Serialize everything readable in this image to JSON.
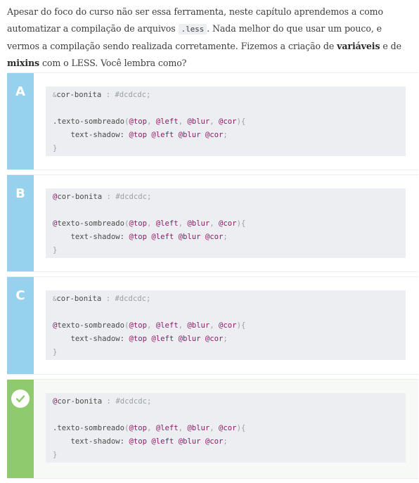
{
  "question": {
    "part1": "Apesar do foco do curso não ser essa ferramenta, neste capítulo aprendemos a como automatizar a compilação de arquivos ",
    "code": ".less",
    "part2": ". Nada melhor do que usar um pouco, e vermos a compilação sendo realizada corretamente. Fizemos a criação de ",
    "bold1": "variáveis",
    "part3": " e de ",
    "bold2": "mixins",
    "part4": " com o LESS. Você lembra como?"
  },
  "options": [
    {
      "letter": "A",
      "var_prefix": "&",
      "var_name": "cor-bonita",
      "var_sep": " : ",
      "var_value": "#dcdcdc;",
      "mixin_prefix": "",
      "mixin_name": ".texto-sombreado",
      "params_open": "(",
      "p1": "@top",
      "p2": "@left",
      "p3": "@blur",
      "p4": "@cor",
      "params_close": ")",
      "brace_open": "{",
      "prop": "text-shadow: ",
      "v1": "@top",
      "v2": "@left",
      "v3": "@blur",
      "v4": "@cor",
      "semi": ";",
      "brace_close": "}"
    },
    {
      "letter": "B",
      "var_prefix": "@",
      "var_name": "cor-bonita",
      "var_sep": " : ",
      "var_value": "#dcdcdc;",
      "mixin_prefix": "@",
      "mixin_name": "texto-sombreado",
      "params_open": "(",
      "p1": "@top",
      "p2": "@left",
      "p3": "@blur",
      "p4": "@cor",
      "params_close": ")",
      "brace_open": "{",
      "prop": "text-shadow: ",
      "v1": "@top",
      "v2": "@left",
      "v3": "@blur",
      "v4": "@cor",
      "semi": ";",
      "brace_close": "}"
    },
    {
      "letter": "C",
      "var_prefix": "&",
      "var_name": "cor-bonita",
      "var_sep": " : ",
      "var_value": "#dcdcdc;",
      "mixin_prefix": "@",
      "mixin_name": "texto-sombreado",
      "params_open": "(",
      "p1": "@top",
      "p2": "@left",
      "p3": "@blur",
      "p4": "@cor",
      "params_close": ")",
      "brace_open": "{",
      "prop": "text-shadow: ",
      "v1": "@top",
      "v2": "@left",
      "v3": "@blur",
      "v4": "@cor",
      "semi": ";",
      "brace_close": "}"
    },
    {
      "letter": "",
      "var_prefix": "@",
      "var_name": "cor-bonita",
      "var_sep": " : ",
      "var_value": "#dcdcdc;",
      "mixin_prefix": "",
      "mixin_name": ".texto-sombreado",
      "params_open": "(",
      "p1": "@top",
      "p2": "@left",
      "p3": "@blur",
      "p4": "@cor",
      "params_close": ")",
      "brace_open": "{",
      "prop": "text-shadow: ",
      "v1": "@top",
      "v2": "@left",
      "v3": "@blur",
      "v4": "@cor",
      "semi": ";",
      "brace_close": "}"
    }
  ],
  "correct_icon": "check-icon",
  "colors": {
    "letter_bar": "#96d1ee",
    "correct_bar": "#8fca6e",
    "code_bg": "#eceef1",
    "at_keyword": "#8a1c66"
  }
}
